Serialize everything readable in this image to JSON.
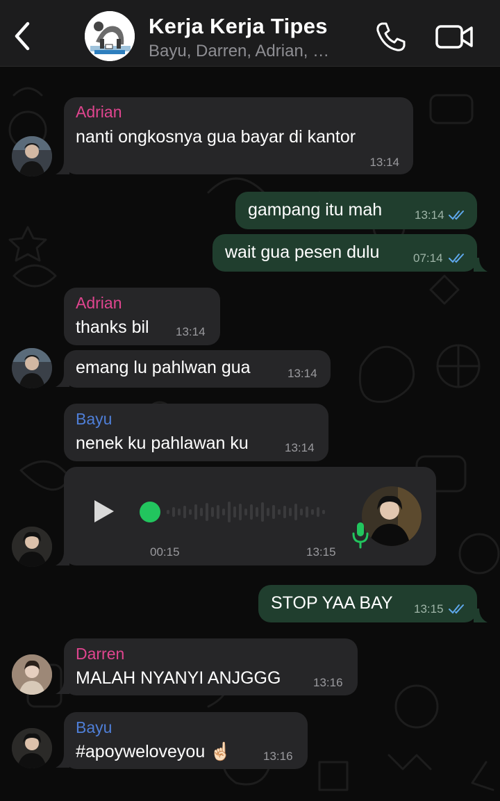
{
  "header": {
    "title": "Kerja Kerja Tipes",
    "members": "Bayu, Darren, Adrian, …"
  },
  "colors": {
    "header_bg": "#1c1c1d",
    "incoming_bubble": "#262628",
    "outgoing_bubble": "#203e2e",
    "adrian_name": "#e0458f",
    "darren_name": "#e0458f",
    "bayu_name": "#4f7fd8",
    "read_ticks": "#5fa9ee",
    "voice_dot": "#22c55e"
  },
  "messages": [
    {
      "id": "m1",
      "direction": "in",
      "sender": "Adrian",
      "text": "nanti ongkosnya gua bayar di kantor",
      "time": "13:14"
    },
    {
      "id": "m2",
      "direction": "out",
      "text": "gampang itu mah",
      "time": "13:14",
      "status": "read-ticks-icon"
    },
    {
      "id": "m3",
      "direction": "out",
      "text": "wait gua pesen dulu",
      "time": "07:14",
      "status": "read-ticks-icon"
    },
    {
      "id": "m4",
      "direction": "in",
      "sender": "Adrian",
      "text": "thanks bil",
      "time": "13:14"
    },
    {
      "id": "m5",
      "direction": "in",
      "text": "emang lu pahlwan gua",
      "time": "13:14"
    },
    {
      "id": "m6",
      "direction": "in",
      "sender": "Bayu",
      "text": "nenek ku pahlawan ku",
      "time": "13:14"
    },
    {
      "id": "m7",
      "direction": "in",
      "type": "voice",
      "duration": "00:15",
      "time": "13:15",
      "progress": 0
    },
    {
      "id": "m8",
      "direction": "out",
      "text": "STOP YAA BAY",
      "time": "13:15",
      "status": "read-ticks-icon"
    },
    {
      "id": "m9",
      "direction": "in",
      "sender": "Darren",
      "text": "MALAH NYANYI ANJGGG",
      "time": "13:16"
    },
    {
      "id": "m10",
      "direction": "in",
      "sender": "Bayu",
      "text": "#apoyweloveyou ☝🏻",
      "time": "13:16"
    }
  ]
}
